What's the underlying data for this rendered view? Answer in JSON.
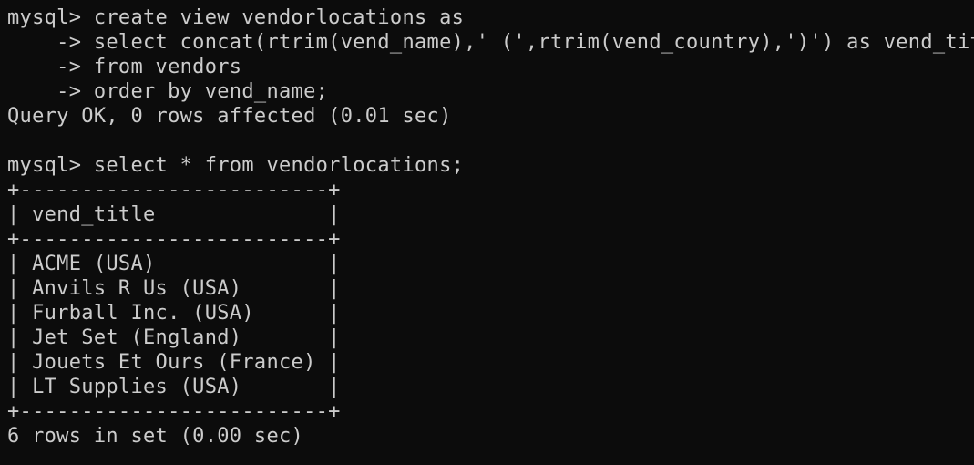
{
  "terminal": {
    "lines": [
      "mysql> create view vendorlocations as",
      "    -> select concat(rtrim(vend_name),' (',rtrim(vend_country),')') as vend_title",
      "    -> from vendors",
      "    -> order by vend_name;",
      "Query OK, 0 rows affected (0.01 sec)",
      "",
      "mysql> select * from vendorlocations;",
      "+-------------------------+",
      "| vend_title              |",
      "+-------------------------+",
      "| ACME (USA)              |",
      "| Anvils R Us (USA)       |",
      "| Furball Inc. (USA)      |",
      "| Jet Set (England)       |",
      "| Jouets Et Ours (France) |",
      "| LT Supplies (USA)       |",
      "+-------------------------+",
      "6 rows in set (0.00 sec)"
    ]
  }
}
